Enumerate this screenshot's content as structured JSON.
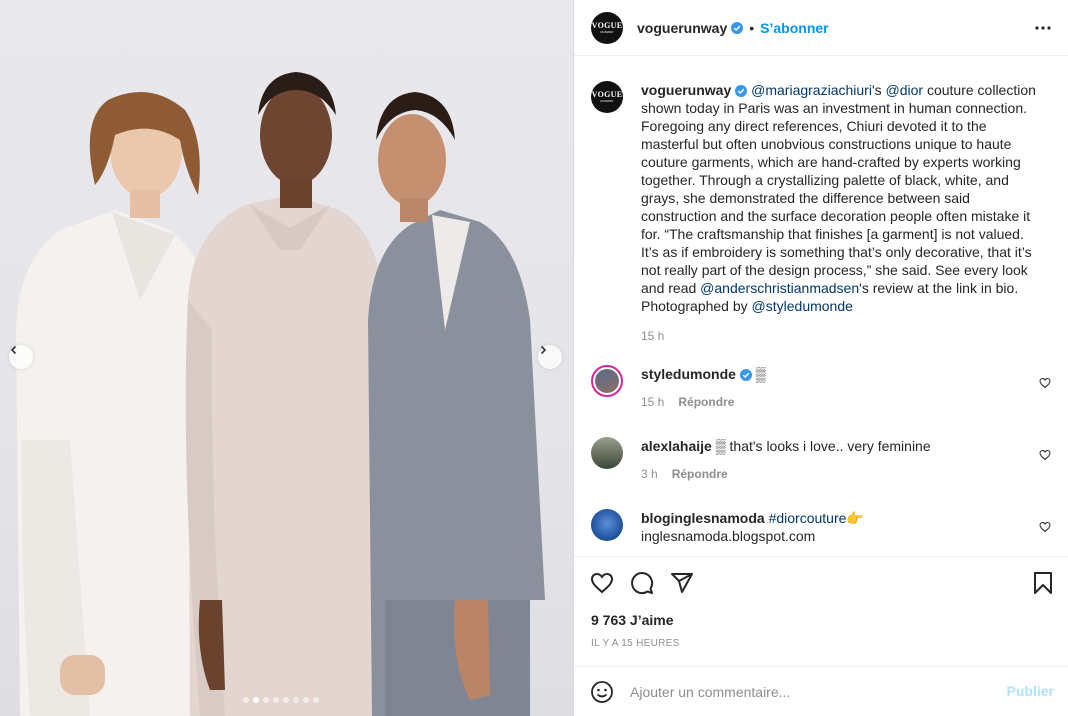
{
  "colors": {
    "accent": "#0095f6",
    "link": "#00376b",
    "muted": "#8e8e8e",
    "verified": "#3897f0"
  },
  "carousel": {
    "prev_icon": "chevron-left-icon",
    "next_icon": "chevron-right-icon",
    "dot_count": 8,
    "active_dot": 1
  },
  "header": {
    "avatar_text_main": "VOGUE",
    "avatar_text_sub": "RUNWAY",
    "username": "voguerunway",
    "bullet": "•",
    "follow_label": "S’abonner",
    "more_icon": "more-horizontal-icon"
  },
  "caption": {
    "username": "voguerunway",
    "mention1": "@mariagraziachiuri",
    "t1": "'s ",
    "mention2": "@dior",
    "t2": " couture collection shown today in Paris was an investment in human connection. Foregoing any direct references, Chiuri devoted it to the masterful but often unobvious constructions unique to haute couture garments, which are hand-crafted by experts working together. Through a crystallizing palette of black, white, and grays, she demonstrated the difference between said construction and the surface decoration people often mistake it for. “The craftsmanship that finishes [a garment] is not valued. It’s as if embroidery is something that’s only decorative, that it’s not really part of the design process,” she said. See every look and read ",
    "mention3": "@anderschristianmadsen",
    "t3": "'s review at the link in bio. Photographed by ",
    "mention4": "@styledumonde",
    "time": "15 h"
  },
  "comments": [
    {
      "username": "styledumonde",
      "text": "▒",
      "time": "15 h",
      "reply": "Répondre"
    },
    {
      "username": "alexlahaije",
      "text": "▒ that's looks i love.. very feminine",
      "time": "3 h",
      "reply": "Répondre"
    },
    {
      "username": "bloginglesnamoda",
      "hashtag": "#diorcouture",
      "emoji": "👉",
      "line2": "inglesnamoda.blogspot.com"
    }
  ],
  "actions": {
    "like_icon": "heart-icon",
    "comment_icon": "comment-icon",
    "share_icon": "share-icon",
    "save_icon": "bookmark-icon",
    "likes": "9 763 J’aime",
    "posted": "IL Y A 15 HEURES"
  },
  "add_comment": {
    "emoji_icon": "smiley-icon",
    "placeholder": "Ajouter un commentaire...",
    "publish_label": "Publier"
  }
}
